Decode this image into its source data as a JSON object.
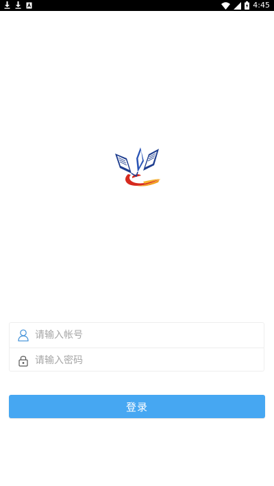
{
  "status_bar": {
    "time": "4:45",
    "left_icons": [
      "download-icon",
      "download-icon",
      "notification-icon"
    ],
    "right_icons": [
      "wifi-icon",
      "signal-icon",
      "battery-icon"
    ]
  },
  "logo": {
    "icon": "book-logo-icon",
    "colors": {
      "blue": "#1f3e8f",
      "red": "#d62a1e",
      "orange": "#f2a020"
    }
  },
  "form": {
    "username": {
      "placeholder": "请输入帐号",
      "value": "",
      "icon": "user-icon"
    },
    "password": {
      "placeholder": "请输入密码",
      "value": "",
      "icon": "lock-icon"
    }
  },
  "login_button": {
    "label": "登录",
    "color": "#46a7f2"
  }
}
